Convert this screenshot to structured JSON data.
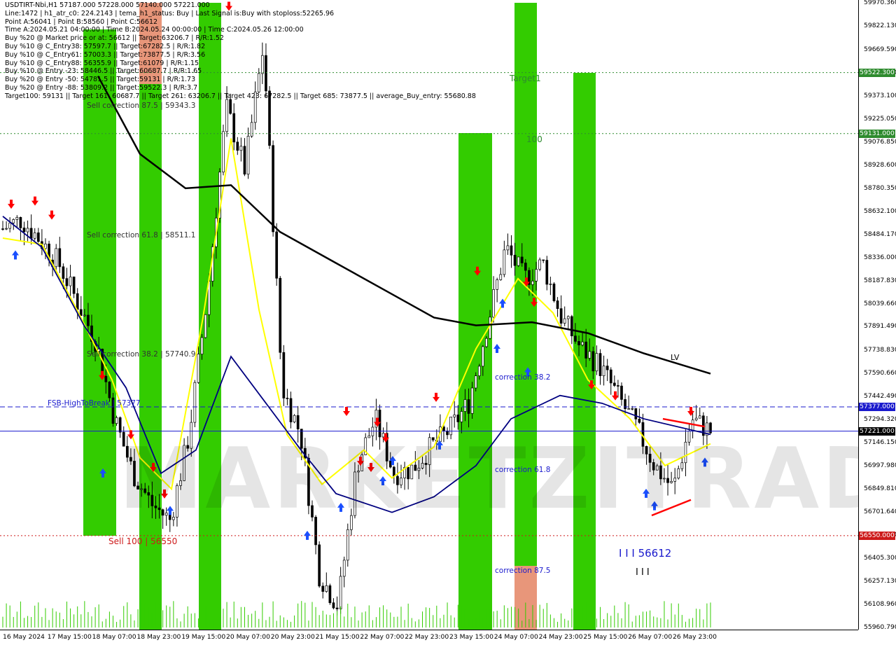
{
  "header": {
    "lines": [
      "USDTIRT-Nbi,H1  57187.000 57228.000 57140.000 57221.000",
      "Line:1472 | h1_atr_c0: 224.2143 | tema_h1_status: Buy | Last Signal is:Buy with stoploss:52265.96",
      "Point A:56041 | Point B:58560 | Point C:56612",
      "Time A:2024.05.21 04:00:00 | Time B:2024.05.24 00:00:00 | Time C:2024.05.26 12:00:00",
      "Buy %20 @ Market price or at: 56612 || Target:63206.7 | R/R:1.52",
      "Buy %10 @ C_Entry38: 57597.7 || Target:67282.5 | R/R:1.82",
      "Buy %10 @ C_Entry61: 57003.3 || Target:73877.5 | R/R:3.56",
      "Buy %10 @ C_Entry88: 56355.9 || Target:61079 | R/R:1.15",
      "Buy %10 @ Entry -23: 58446.5 || Target:60687.7 | R/R:1.65",
      "Buy %20 @ Entry -50: 54781.5 || Target:59131 | R/R:1.73",
      "Buy %20 @ Entry -88: 53809.2 || Target:59522.3 | R/R:3.7",
      "Target100: 59131 || Target 161: 60687.7 || Target 261: 63206.7 || Target 423: 67282.5 || Target 685: 73877.5 || average_Buy_entry: 55680.88"
    ]
  },
  "price_scale": {
    "labels": [
      "59970.360",
      "59822.130",
      "59669.590",
      "59521.350",
      "59373.100",
      "59225.050",
      "59076.850",
      "58928.600",
      "58780.350",
      "58632.100",
      "58484.170",
      "58336.000",
      "58187.830",
      "58039.660",
      "57891.490",
      "57738.830",
      "57590.660",
      "57442.490",
      "57294.320",
      "57146.150",
      "56997.980",
      "56849.810",
      "56701.640",
      "56553.470",
      "56405.300",
      "56257.130",
      "56108.960",
      "55960.790"
    ],
    "badges": [
      {
        "text": "59522.300",
        "bg": "#2e8b2e",
        "fg": "#ffffff",
        "price": 59522.3
      },
      {
        "text": "59131.000",
        "bg": "#2e8b2e",
        "fg": "#ffffff",
        "price": 59131.0
      },
      {
        "text": "57377.000",
        "bg": "#1a1acd",
        "fg": "#ffffff",
        "price": 57377.0
      },
      {
        "text": "57221.000",
        "bg": "#000000",
        "fg": "#ffffff",
        "price": 57221.0
      },
      {
        "text": "56550.000",
        "bg": "#cd1a1a",
        "fg": "#ffffff",
        "price": 56550.0
      }
    ]
  },
  "time_scale": {
    "labels": [
      "16 May 2024",
      "17 May 15:00",
      "18 May 07:00",
      "18 May 23:00",
      "19 May 15:00",
      "20 May 07:00",
      "20 May 23:00",
      "21 May 15:00",
      "22 May 07:00",
      "22 May 23:00",
      "23 May 15:00",
      "24 May 07:00",
      "24 May 23:00",
      "25 May 15:00",
      "26 May 07:00",
      "26 May 23:00"
    ]
  },
  "annotations": {
    "sell_correction_875": "Sell correction 87.5 | 59343.3",
    "sell_correction_618": "Sell correction 61.8 | 58511.1",
    "sell_correction_382": "Sell correction 38.2 | 57740.9",
    "fsb": "FSB-HighToBreak | 57377",
    "sell_100": "Sell 100 | 56550",
    "target1": "Target1",
    "level_100": "100",
    "correction_382": "correction 38.2",
    "correction_618": "correction 61.8",
    "correction_875": "correction 87.5",
    "point_c": "I I I 56612",
    "point_c_marks": "I I I",
    "lv_mark": "LV",
    "watermark": "MARKETZITRADE"
  },
  "colors": {
    "green_zone": "#33cc00",
    "orange_zone": "#e8967a",
    "yellow_line": "#ffff00",
    "navy_line": "#000080",
    "black_line": "#000000",
    "buy_arrow": "#1a4fff",
    "sell_arrow": "#ff0000",
    "level_green": "#2e8b2e",
    "level_blue": "#1a1acd",
    "level_red": "#cd1a1a"
  },
  "chart_data": {
    "type": "candlestick",
    "symbol": "USDTIRT-Nbi",
    "timeframe": "H1",
    "ohlc_last": {
      "open": 57187.0,
      "high": 57228.0,
      "low": 57140.0,
      "close": 57221.0
    },
    "ylim": [
      55960.79,
      59970.36
    ],
    "levels": [
      {
        "name": "Target 59522.3",
        "price": 59522.3
      },
      {
        "name": "Target 59131",
        "price": 59131.0
      },
      {
        "name": "FSB-HighToBreak",
        "price": 57377.0
      },
      {
        "name": "Last price",
        "price": 57221.0
      },
      {
        "name": "Sell 100",
        "price": 56550.0
      }
    ],
    "close_path": [
      [
        "16 May 2024",
        58520
      ],
      [
        "16 May",
        58580
      ],
      [
        "16 May",
        58450
      ],
      [
        "17 May",
        58300
      ],
      [
        "17 May 15:00",
        58050
      ],
      [
        "17 May",
        57800
      ],
      [
        "18 May 07:00",
        57300
      ],
      [
        "18 May",
        56950
      ],
      [
        "18 May",
        56750
      ],
      [
        "18 May 23:00",
        56650
      ],
      [
        "19 May",
        57200
      ],
      [
        "19 May",
        58100
      ],
      [
        "19 May 15:00",
        59300
      ],
      [
        "19 May",
        58900
      ],
      [
        "20 May 07:00",
        59700
      ],
      [
        "20 May",
        57500
      ],
      [
        "20 May",
        57200
      ],
      [
        "20 May 23:00",
        56300
      ],
      [
        "21 May",
        56100
      ],
      [
        "21 May",
        57000
      ],
      [
        "21 May 15:00",
        57300
      ],
      [
        "22 May",
        56950
      ],
      [
        "22 May 07:00",
        56980
      ],
      [
        "22 May",
        57120
      ],
      [
        "22 May 23:00",
        57230
      ],
      [
        "23 May",
        57400
      ],
      [
        "23 May 15:00",
        57900
      ],
      [
        "23 May",
        58400
      ],
      [
        "24 May",
        58200
      ],
      [
        "24 May 07:00",
        58300
      ],
      [
        "24 May",
        57950
      ],
      [
        "24 May",
        57760
      ],
      [
        "24 May 23:00",
        57650
      ],
      [
        "25 May",
        57450
      ],
      [
        "25 May 15:00",
        57250
      ],
      [
        "26 May",
        57000
      ],
      [
        "26 May 07:00",
        56850
      ],
      [
        "26 May",
        57300
      ],
      [
        "26 May 23:00",
        57221
      ]
    ]
  }
}
